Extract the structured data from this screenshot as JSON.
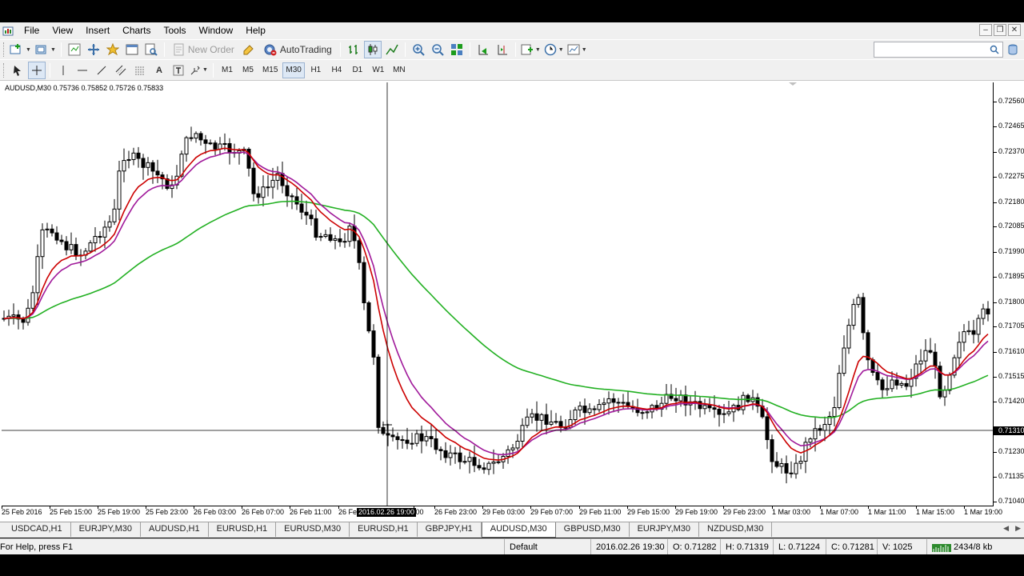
{
  "menu": [
    "File",
    "View",
    "Insert",
    "Charts",
    "Tools",
    "Window",
    "Help"
  ],
  "toolbar": {
    "new_order": "New Order",
    "autotrading": "AutoTrading"
  },
  "timeframes": [
    "M1",
    "M5",
    "M15",
    "M30",
    "H1",
    "H4",
    "D1",
    "W1",
    "MN"
  ],
  "active_timeframe": "M30",
  "chart": {
    "symbol_info": "AUDUSD,M30  0.75736 0.75852 0.75726 0.75833",
    "price_labels": [
      "0.72560",
      "0.72465",
      "0.72370",
      "0.72275",
      "0.72180",
      "0.72085",
      "0.71990",
      "0.71895",
      "0.71800",
      "0.71705",
      "0.71610",
      "0.71515",
      "0.71420",
      "0.71310",
      "0.71230",
      "0.71135",
      "0.71040"
    ],
    "current_price": "0.71310",
    "time_labels": [
      "25 Feb 2016",
      "25 Feb 15:00",
      "25 Feb 19:00",
      "25 Feb 23:00",
      "26 Feb 03:00",
      "26 Feb 07:00",
      "26 Feb 11:00",
      "26 Fe",
      ":00",
      "26 Feb 23:00",
      "29 Feb 03:00",
      "29 Feb 07:00",
      "29 Feb 11:00",
      "29 Feb 15:00",
      "29 Feb 19:00",
      "29 Feb 23:00",
      "1 Mar 03:00",
      "1 Mar 07:00",
      "1 Mar 11:00",
      "1 Mar 15:00",
      "1 Mar 19:00"
    ],
    "crosshair_time": "2016.02.26 19:00",
    "colors": {
      "ma_fast": "#cc0000",
      "ma_mid": "#a0199a",
      "ma_slow": "#22b022",
      "candle": "#000000"
    }
  },
  "tabs": [
    "USDCAD,H1",
    "EURJPY,M30",
    "AUDUSD,H1",
    "EURUSD,H1",
    "EURUSD,M30",
    "EURUSD,H1",
    "GBPJPY,H1",
    "AUDUSD,M30",
    "GBPUSD,M30",
    "EURJPY,M30",
    "NZDUSD,M30"
  ],
  "active_tab": "AUDUSD,M30",
  "status": {
    "help": "For Help, press F1",
    "profile": "Default",
    "datetime": "2016.02.26 19:30",
    "open": "O: 0.71282",
    "high": "H: 0.71319",
    "low": "L: 0.71224",
    "close": "C: 0.71281",
    "volume": "V: 1025",
    "traffic": "2434/8 kb"
  }
}
